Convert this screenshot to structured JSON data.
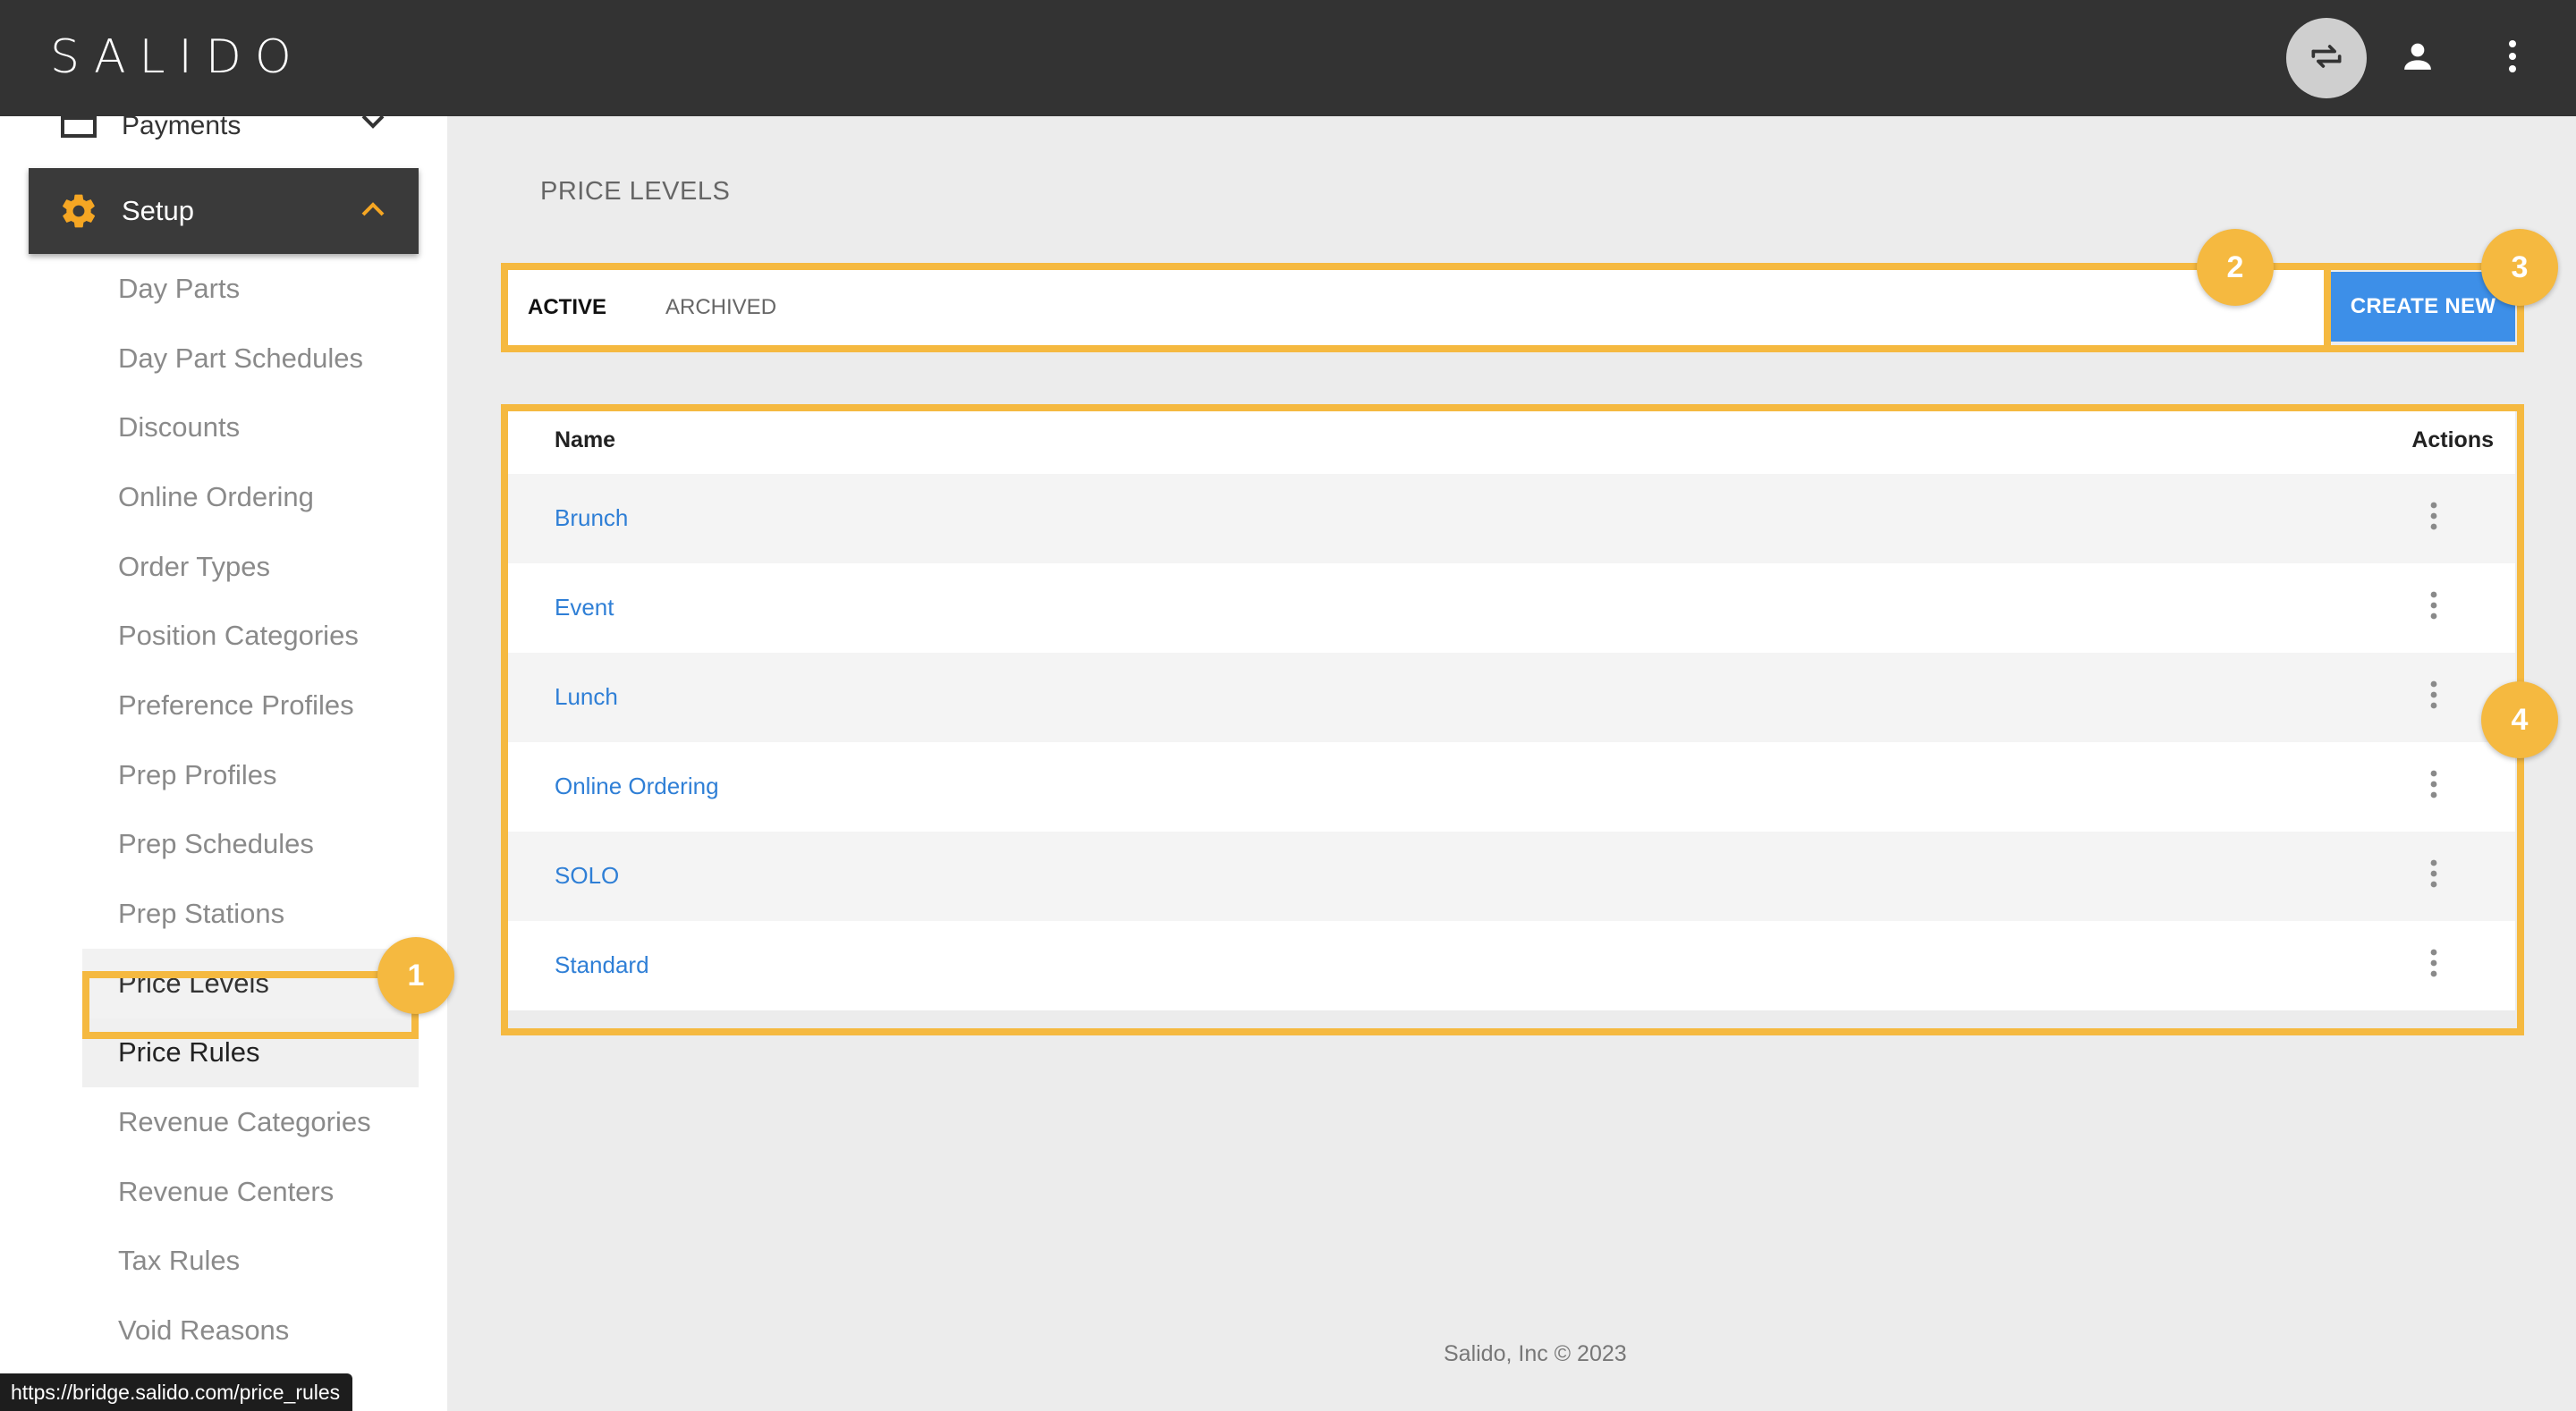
{
  "app": {
    "logo": "SALIDO"
  },
  "topbar": {
    "swap_icon": "swap-icon",
    "user_icon": "user-icon",
    "more_icon": "more-vert-icon"
  },
  "sidebar": {
    "payments_label": "Payments",
    "setup_label": "Setup",
    "items": [
      {
        "label": "Day Parts"
      },
      {
        "label": "Day Part Schedules"
      },
      {
        "label": "Discounts"
      },
      {
        "label": "Online Ordering"
      },
      {
        "label": "Order Types"
      },
      {
        "label": "Position Categories"
      },
      {
        "label": "Preference Profiles"
      },
      {
        "label": "Prep Profiles"
      },
      {
        "label": "Prep Schedules"
      },
      {
        "label": "Prep Stations"
      },
      {
        "label": "Price Levels"
      },
      {
        "label": "Price Rules"
      },
      {
        "label": "Revenue Categories"
      },
      {
        "label": "Revenue Centers"
      },
      {
        "label": "Tax Rules"
      },
      {
        "label": "Void Reasons"
      }
    ],
    "selected": "Price Levels",
    "hovered": "Price Rules"
  },
  "status_bar": {
    "url": "https://bridge.salido.com/price_rules"
  },
  "main": {
    "title": "PRICE LEVELS",
    "tabs": [
      {
        "label": "ACTIVE",
        "active": true
      },
      {
        "label": "ARCHIVED",
        "active": false
      }
    ],
    "create_button": "CREATE NEW",
    "table": {
      "columns": [
        "Name",
        "Actions"
      ],
      "rows": [
        {
          "name": "Brunch"
        },
        {
          "name": "Event"
        },
        {
          "name": "Lunch"
        },
        {
          "name": "Online Ordering"
        },
        {
          "name": "SOLO"
        },
        {
          "name": "Standard"
        }
      ]
    }
  },
  "footer": {
    "text": "Salido, Inc © 2023"
  },
  "annotations": {
    "badges": [
      "1",
      "2",
      "3",
      "4"
    ],
    "color": "#f5b940"
  },
  "colors": {
    "topbar": "#333333",
    "accent_blue": "#3d8fe8",
    "link_blue": "#2f7fd6",
    "gear_orange": "#f5a623"
  }
}
